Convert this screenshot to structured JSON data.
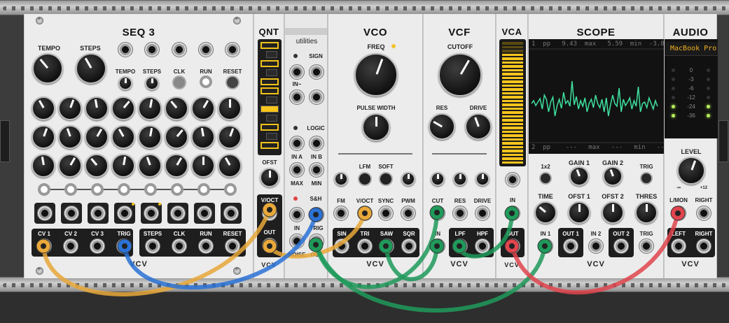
{
  "modules": {
    "seq3": {
      "title": "SEQ 3",
      "tempo": "TEMPO",
      "steps": "STEPS",
      "small": [
        "TEMPO",
        "STEPS",
        "CLK",
        "RUN",
        "RESET"
      ],
      "outs": [
        "CV 1",
        "CV 2",
        "CV 3",
        "TRIG"
      ],
      "outs2": [
        "STEPS",
        "CLK",
        "RUN",
        "RESET"
      ],
      "logo": "VCV"
    },
    "qnt": {
      "title": "QNT",
      "ofst": "OFST",
      "voct": "V/OCT",
      "out": "OUT",
      "logo": "VCV"
    },
    "utilities": {
      "title": "utilities",
      "sign": "SIGN",
      "logic": "LOGIC",
      "ina": "IN A",
      "inb": "IN B",
      "max": "MAX",
      "min": "MIN",
      "sh": "S&H",
      "in": "IN",
      "trig": "TRIG",
      "noise": "NOISE",
      "out": "OUT",
      "sym1": "IN~",
      "sym2": "∫",
      "sym3": "~",
      "sym4": "∫∫"
    },
    "vco": {
      "title": "VCO",
      "freq": "FREQ",
      "pw": "PULSE WIDTH",
      "lfm": "LFM",
      "soft": "SOFT",
      "fm": "FM",
      "voct": "V/OCT",
      "sync": "SYNC",
      "pwm": "PWM",
      "outs": [
        "SIN",
        "TRI",
        "SAW",
        "SQR"
      ],
      "logo": "VCV"
    },
    "vcf": {
      "title": "VCF",
      "cutoff": "CUTOFF",
      "res": "RES",
      "drive": "DRIVE",
      "cut": "CUT",
      "res2": "RES",
      "drive2": "DRIVE",
      "in": "IN",
      "lpf": "LPF",
      "hpf": "HPF",
      "logo": "VCV"
    },
    "vca": {
      "title": "VCA",
      "in": "IN",
      "out": "OUT",
      "logo": "VCV"
    },
    "scope": {
      "title": "SCOPE",
      "top": "1  pp   9.43  max   5.59  min  -3.84",
      "bottom": "2  pp    ---   max   ---   min   ---",
      "x1x2": "1x2",
      "gain1": "GAIN 1",
      "gain2": "GAIN 2",
      "trig": "TRIG",
      "time": "TIME",
      "ofst1": "OFST 1",
      "ofst2": "OFST 2",
      "thres": "THRES",
      "in1": "IN 1",
      "out1": "OUT 1",
      "in2": "IN 2",
      "out2": "OUT 2",
      "trig2": "TRIG",
      "logo": "VCV"
    },
    "audio": {
      "title": "AUDIO",
      "device": "MacBook Pro",
      "levels": [
        "0",
        "-3",
        "-6",
        "-12",
        "-24",
        "-36"
      ],
      "level": "LEVEL",
      "min": "-∞",
      "max": "+12",
      "lmon": "L/MON",
      "right": "RIGHT",
      "left": "LEFT",
      "right2": "RIGHT",
      "logo": "VCV"
    }
  },
  "colors": {
    "yellow_cable": "#e8a83a",
    "blue_cable": "#2a72d6",
    "green_cable": "#1f9a5a",
    "red_cable": "#e0454e",
    "scope_trace": "#3fe0a0",
    "led_yellow": "#f7c51c"
  }
}
